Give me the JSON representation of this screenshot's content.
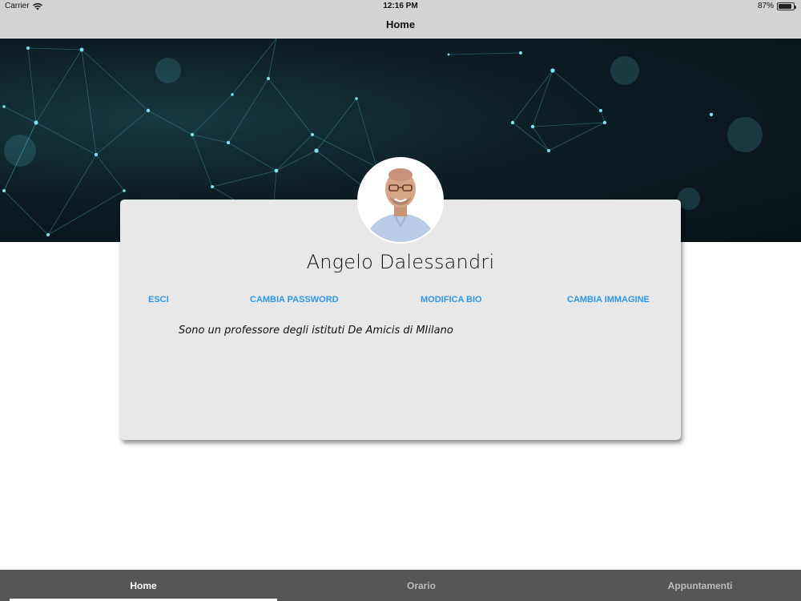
{
  "status_bar": {
    "carrier": "Carrier",
    "time": "12:16 PM",
    "battery": "87%",
    "battery_level": 0.87
  },
  "nav": {
    "title": "Home"
  },
  "profile": {
    "name": "Angelo Dalessandri",
    "bio": "Sono un professore degli istituti De Amicis di MIilano",
    "actions": {
      "logout": "ESCI",
      "change_password": "CAMBIA PASSWORD",
      "edit_bio": "MODIFICA BIO",
      "change_image": "CAMBIA IMMAGINE"
    }
  },
  "tabs": [
    {
      "label": "Home",
      "active": true
    },
    {
      "label": "Orario",
      "active": false
    },
    {
      "label": "Appuntamenti",
      "active": false
    }
  ],
  "colors": {
    "accent": "#2f96e6",
    "topbar": "#d3d3d3",
    "tabbar": "#555555",
    "card": "#e8e8e8",
    "banner": "#0c1d24"
  },
  "icons": {
    "wifi": "wifi-icon",
    "battery": "battery-icon",
    "avatar": "profile-photo"
  }
}
